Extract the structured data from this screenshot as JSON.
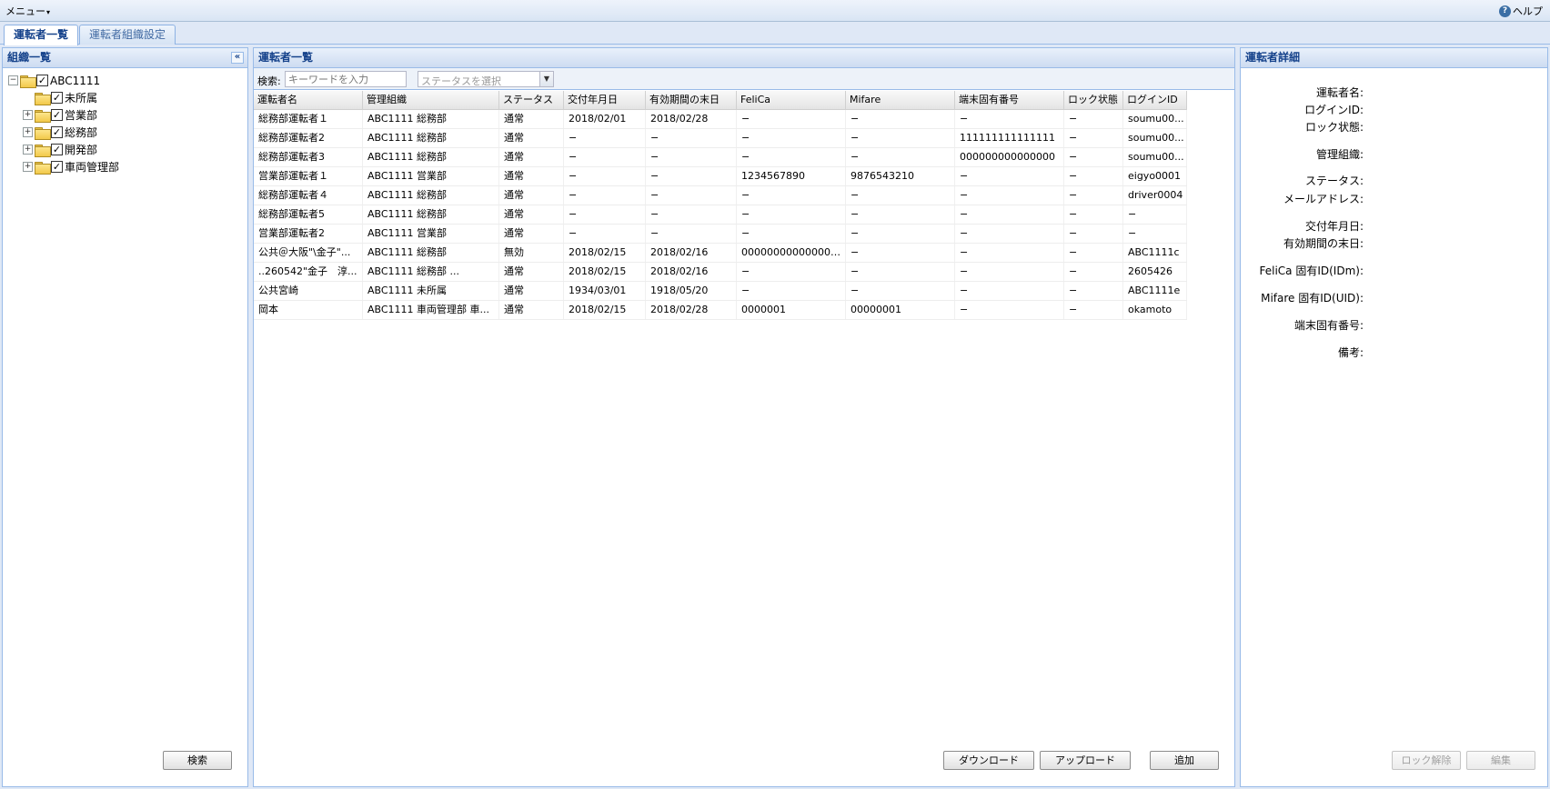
{
  "menubar": {
    "menu_label": "メニュー",
    "help_label": "ヘルプ"
  },
  "tabs": [
    {
      "label": "運転者一覧",
      "active": true
    },
    {
      "label": "運転者組織設定",
      "active": false
    }
  ],
  "left_panel": {
    "title": "組織一覧",
    "tree": [
      {
        "label": "ABC1111",
        "expander": "−",
        "checked": true
      },
      {
        "label": "未所属",
        "expander": "",
        "checked": true
      },
      {
        "label": "営業部",
        "expander": "+",
        "checked": true
      },
      {
        "label": "総務部",
        "expander": "+",
        "checked": true
      },
      {
        "label": "開発部",
        "expander": "+",
        "checked": true
      },
      {
        "label": "車両管理部",
        "expander": "+",
        "checked": true
      }
    ],
    "search_button": "検索"
  },
  "center_panel": {
    "title": "運転者一覧",
    "search_label": "検索:",
    "keyword_placeholder": "キーワードを入力",
    "status_placeholder": "ステータスを選択",
    "columns": [
      "運転者名",
      "管理組織",
      "ステータス",
      "交付年月日",
      "有効期間の末日",
      "FeliCa",
      "Mifare",
      "端末固有番号",
      "ロック状態",
      "ログインID"
    ],
    "rows": [
      [
        "総務部運転者１",
        "ABC1111 総務部",
        "通常",
        "2018/02/01",
        "2018/02/28",
        "−",
        "−",
        "−",
        "−",
        "soumu00..."
      ],
      [
        "総務部運転者2",
        "ABC1111 総務部",
        "通常",
        "−",
        "−",
        "−",
        "−",
        "111111111111111",
        "−",
        "soumu00..."
      ],
      [
        "総務部運転者3",
        "ABC1111 総務部",
        "通常",
        "−",
        "−",
        "−",
        "−",
        "000000000000000",
        "−",
        "soumu00..."
      ],
      [
        "営業部運転者１",
        "ABC1111 営業部",
        "通常",
        "−",
        "−",
        "1234567890",
        "9876543210",
        "−",
        "−",
        "eigyo0001"
      ],
      [
        "総務部運転者４",
        "ABC1111 総務部",
        "通常",
        "−",
        "−",
        "−",
        "−",
        "−",
        "−",
        "driver0004"
      ],
      [
        "総務部運転者5",
        "ABC1111 総務部",
        "通常",
        "−",
        "−",
        "−",
        "−",
        "−",
        "−",
        "−"
      ],
      [
        "営業部運転者2",
        "ABC1111 営業部",
        "通常",
        "−",
        "−",
        "−",
        "−",
        "−",
        "−",
        "−"
      ],
      [
        "公共＠大阪\"\\金子\"...",
        "ABC1111 総務部",
        "無効",
        "2018/02/15",
        "2018/02/16",
        "000000000000000...",
        "−",
        "−",
        "−",
        "ABC1111c"
      ],
      [
        "..260542\"金子　淳...",
        "ABC1111 総務部 ...",
        "通常",
        "2018/02/15",
        "2018/02/16",
        "−",
        "−",
        "−",
        "−",
        "2605426"
      ],
      [
        "公共宮崎",
        "ABC1111 未所属",
        "通常",
        "1934/03/01",
        "1918/05/20",
        "−",
        "−",
        "−",
        "−",
        "ABC1111e"
      ],
      [
        "岡本",
        "ABC1111 車両管理部 車...",
        "通常",
        "2018/02/15",
        "2018/02/28",
        "0000001",
        "00000001",
        "−",
        "−",
        "okamoto"
      ]
    ],
    "download_button": "ダウンロード",
    "upload_button": "アップロード",
    "add_button": "追加"
  },
  "right_panel": {
    "title": "運転者詳細",
    "fields": [
      {
        "label": "運転者名:"
      },
      {
        "label": "ログインID:"
      },
      {
        "label": "ロック状態:"
      },
      {
        "label": "管理組織:"
      },
      {
        "label": "ステータス:"
      },
      {
        "label": "メールアドレス:"
      },
      {
        "label": "交付年月日:"
      },
      {
        "label": "有効期間の末日:"
      },
      {
        "label": "FeliCa 固有ID(IDm):"
      },
      {
        "label": "Mifare 固有ID(UID):"
      },
      {
        "label": "端末固有番号:"
      },
      {
        "label": "備考:"
      }
    ],
    "unlock_button": "ロック解除",
    "edit_button": "編集"
  }
}
